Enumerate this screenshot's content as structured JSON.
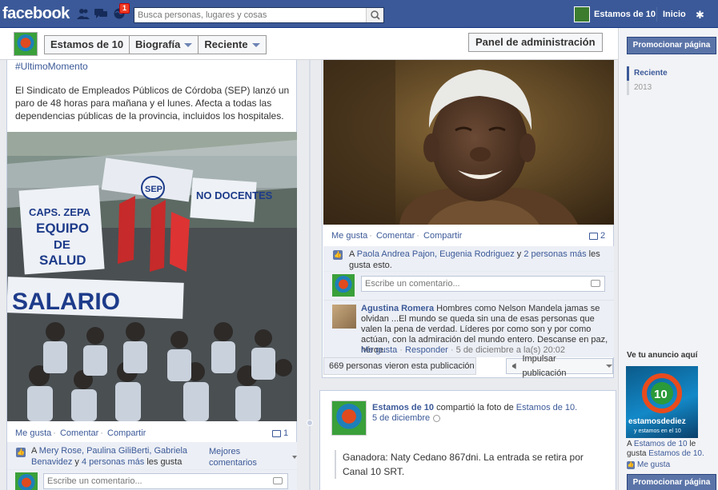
{
  "topbar": {
    "logo": "facebook",
    "notifications_count": "1",
    "search_placeholder": "Busca personas, lugares y cosas",
    "page_name": "Estamos de 10",
    "home": "Inicio"
  },
  "header": {
    "page_name": "Estamos de 10",
    "biography": "Biografía",
    "recent": "Reciente",
    "admin_panel": "Panel de administración"
  },
  "left_post": {
    "hashtag": "#UltimoMomento",
    "text": "El Sindicato de Empleados Públicos de Córdoba (SEP) lanzó un paro de 48 horas para mañana y el lunes. Afecta a todas las dependencias públicas de la provincia, incluidos los hospitales.",
    "photo_banner_1": "CAPS. ZEPA",
    "photo_banner_2": "EQUIPO",
    "photo_banner_3": "DE",
    "photo_banner_4": "SALUD",
    "photo_banner_5": "SALARIO",
    "photo_banner_6": "SEP",
    "photo_banner_7": "NO DOCENTES",
    "actions": {
      "like": "Me gusta",
      "comment": "Comentar",
      "share": "Compartir"
    },
    "comment_count": "1",
    "likes_prefix": "A ",
    "likes_names": "Mery Rose, Paulina GiliBerti, Gabriela Benavidez",
    "likes_middle": " y ",
    "likes_more": "4 personas más",
    "likes_suffix": " les gusta esto.",
    "best_comments": "Mejores comentarios",
    "comment_placeholder": "Escribe un comentario..."
  },
  "right_post": {
    "actions": {
      "like": "Me gusta",
      "comment": "Comentar",
      "share": "Compartir"
    },
    "comment_count": "2",
    "likes_prefix": "A ",
    "likes_names": "Paola Andrea Pajon, Eugenia Rodriguez",
    "likes_middle": " y ",
    "likes_more": "2 personas más",
    "likes_suffix": " les gusta esto.",
    "comment_placeholder": "Escribe un comentario...",
    "comment": {
      "author": "Agustina Romera",
      "text": " Hombres como Nelson Mandela jamas se olvidan ...El mundo se queda sin una de esas personas que valen la pena de verdad. Líderes por como son y por como actúan, con la admiración del mundo entero. Descanse en paz, héroe.",
      "like": "Me gusta",
      "reply": "Responder",
      "time": "5 de diciembre a la(s) 20:02"
    },
    "seen": "669 personas vieron esta publicación",
    "boost": "Impulsar publicación"
  },
  "right_post_2": {
    "author": "Estamos de 10",
    "shared": " compartió la foto de ",
    "shared_link": "Estamos de 10.",
    "date": "5 de diciembre",
    "quote": "Ganadora: Naty Cedano 867dni. La entrada se retira por Canal 10 SRT."
  },
  "sidebar": {
    "promote_top": "Promocionar página",
    "recent": "Reciente",
    "year": "2013",
    "ad_heading": "Ve tu anuncio aquí",
    "ad_banner_1": "estamosdediez",
    "ad_banner_2": "y estamos en el 10",
    "ad_text_prefix": "A ",
    "ad_text_link1": "Estamos de 10",
    "ad_text_middle": " le gusta ",
    "ad_text_link2": "Estamos de 10.",
    "ad_like": "Me gusta",
    "promote_bottom": "Promocionar página"
  },
  "colors": {
    "facebook_blue": "#3b5998",
    "background": "#e9ebee",
    "notification_red": "#f03d25"
  }
}
